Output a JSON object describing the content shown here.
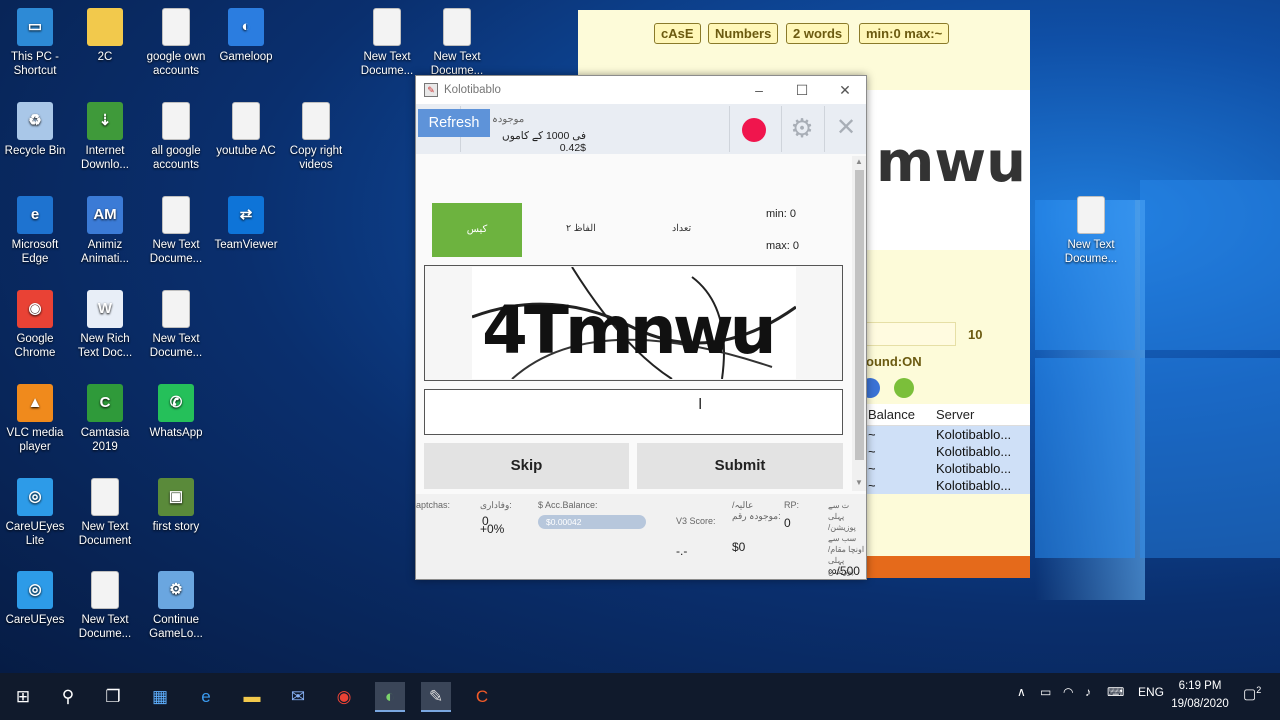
{
  "desktop": {
    "icons": [
      {
        "label": "This PC - Shortcut",
        "icon": "pc-icon"
      },
      {
        "label": "2C",
        "icon": "folder-icon"
      },
      {
        "label": "google own accounts",
        "icon": "document-icon"
      },
      {
        "label": "Gameloop",
        "icon": "gameloop-icon"
      },
      {
        "label": "New Text Docume...",
        "icon": "document-icon"
      },
      {
        "label": "New Text Docume...",
        "icon": "document-icon"
      },
      {
        "label": "Recycle Bin",
        "icon": "recycle-bin-icon"
      },
      {
        "label": "Internet Downlo...",
        "icon": "idm-icon"
      },
      {
        "label": "all google accounts",
        "icon": "document-icon"
      },
      {
        "label": "youtube AC",
        "icon": "document-icon"
      },
      {
        "label": "Copy right videos",
        "icon": "document-icon"
      },
      {
        "label": "Microsoft Edge",
        "icon": "edge-icon"
      },
      {
        "label": "Animiz Animati...",
        "icon": "animiz-icon"
      },
      {
        "label": "New Text Docume...",
        "icon": "document-icon"
      },
      {
        "label": "TeamViewer",
        "icon": "teamviewer-icon"
      },
      {
        "label": "Google Chrome",
        "icon": "chrome-icon"
      },
      {
        "label": "New Rich Text Doc...",
        "icon": "rich-text-icon"
      },
      {
        "label": "New Text Docume...",
        "icon": "document-icon"
      },
      {
        "label": "VLC media player",
        "icon": "vlc-icon"
      },
      {
        "label": "Camtasia 2019",
        "icon": "camtasia-icon"
      },
      {
        "label": "WhatsApp",
        "icon": "whatsapp-icon"
      },
      {
        "label": "CareUEyes Lite",
        "icon": "eye-icon"
      },
      {
        "label": "New Text Document",
        "icon": "document-icon"
      },
      {
        "label": "first story",
        "icon": "image-icon"
      },
      {
        "label": "CareUEyes",
        "icon": "eye-icon"
      },
      {
        "label": "New Text Docume...",
        "icon": "document-icon"
      },
      {
        "label": "Continue GameLo...",
        "icon": "setup-icon"
      },
      {
        "label": "New Text Docume...",
        "icon": "document-icon"
      }
    ]
  },
  "bg_window": {
    "tags": [
      "cAsE",
      "Numbers",
      "2 words",
      "min:0 max:~"
    ],
    "captcha_text": "mwu",
    "count": "10",
    "sound": "ound:ON",
    "table": {
      "headers": [
        "Balance",
        "Server"
      ],
      "rows": [
        [
          "~",
          "Kolotibablo..."
        ],
        [
          "~",
          "Kolotibablo..."
        ],
        [
          "~",
          "Kolotibablo..."
        ],
        [
          "~",
          "Kolotibablo..."
        ]
      ]
    }
  },
  "app": {
    "title": "Kolotibablo",
    "toolbar": {
      "refresh_label": "Refresh",
      "current_label": "موجودہ",
      "rate_text": "فی 1000 کے کاموں 0.42$"
    },
    "options": {
      "case": "کیس",
      "two_words": "۲ الفاظ",
      "numbers": "تعداد",
      "min": "min: 0",
      "max": "max: 0"
    },
    "captcha_text": "4Tmnwu",
    "answer_value": "",
    "buttons": {
      "skip": "Skip",
      "submit": "Submit"
    },
    "status": {
      "captchas_label": "aptchas:",
      "loyalty_label": "وفاداری:",
      "loyalty_value": "0",
      "loyalty_pct": "+0%",
      "balance_label": "$ Acc.Balance:",
      "balance_value": "$0.00042",
      "v3_label": "V3 Score:",
      "v3_value": "-.-",
      "current_balance_label": "عالیہ/ موجودہ رقم:",
      "current_balance_value": "$0",
      "rp_label": "RP:",
      "rp_value": "0",
      "position_label": "ت سے پہلی پوزیشن/سب سے اونچا مقام/پہلی پوزیشن",
      "position_value": "∞/500"
    }
  },
  "taskbar": {
    "language": "ENG",
    "time": "6:19 PM",
    "date": "19/08/2020",
    "notifications": "2"
  }
}
